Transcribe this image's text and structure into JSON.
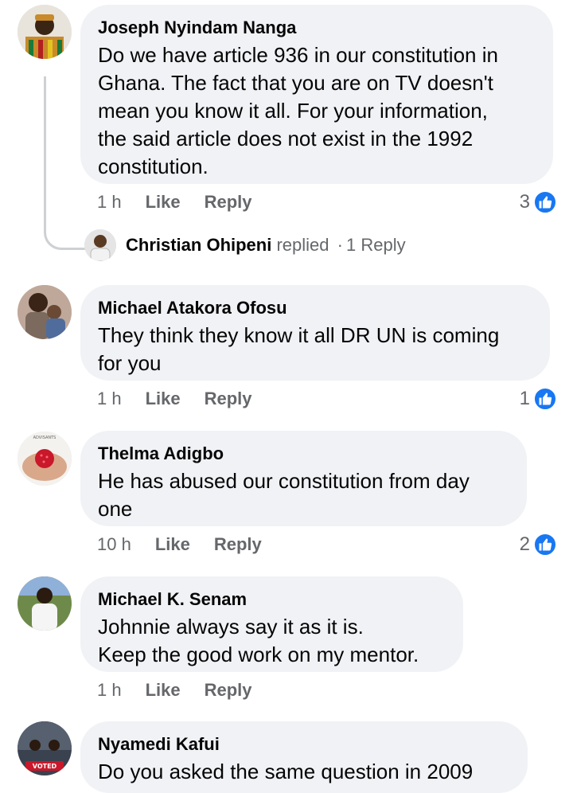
{
  "comments": [
    {
      "author": "Joseph Nyindam Nanga",
      "text": "Do we have article 936 in our constitution in\nGhana. The fact that you are on TV doesn't\nmean you know it all. For your information,\nthe said article does not exist in the 1992\nconstitution.",
      "time": "1 h",
      "like_label": "Like",
      "reply_label": "Reply",
      "reaction_count": "3"
    },
    {
      "author": "Michael Atakora Ofosu",
      "text": "They think they know it all DR UN is coming\nfor you",
      "time": "1 h",
      "like_label": "Like",
      "reply_label": "Reply",
      "reaction_count": "1"
    },
    {
      "author": "Thelma Adigbo",
      "text": "He has abused our constitution  from day\none",
      "time": "10 h",
      "like_label": "Like",
      "reply_label": "Reply",
      "reaction_count": "2"
    },
    {
      "author": "Michael K. Senam",
      "text": "Johnnie always say it as it is.\nKeep the good work on my mentor.",
      "time": "1 h",
      "like_label": "Like",
      "reply_label": "Reply"
    },
    {
      "author": "Nyamedi Kafui",
      "text": "Do you asked the same question  in 2009"
    }
  ],
  "reply_summary": {
    "name": "Christian Ohipeni",
    "action": "replied",
    "separator": "·",
    "count_label": "1 Reply"
  },
  "avatar_fragments": {
    "thelma_avatar_text": "ADVISANTS",
    "nyamedi_avatar_text": "VOTED"
  },
  "colors": {
    "bubble_bg": "#f0f2f5",
    "meta_gray": "#65676b",
    "like_blue": "#1877f2",
    "thread_line": "#ced0d4"
  },
  "icons": {
    "reaction": "thumbs-up-icon"
  }
}
